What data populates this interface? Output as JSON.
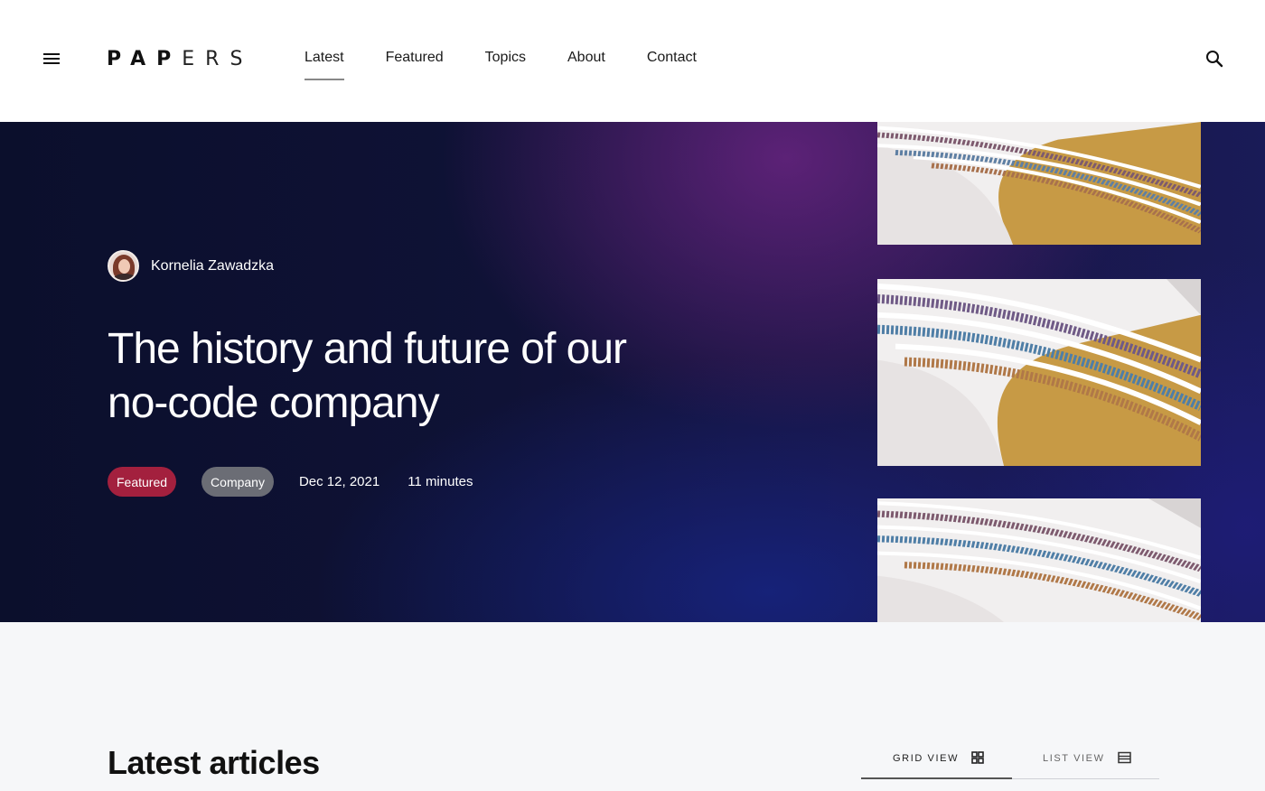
{
  "header": {
    "logo_bold": "PAP",
    "logo_light": "ERS",
    "nav": [
      {
        "label": "Latest",
        "active": true
      },
      {
        "label": "Featured",
        "active": false
      },
      {
        "label": "Topics",
        "active": false
      },
      {
        "label": "About",
        "active": false
      },
      {
        "label": "Contact",
        "active": false
      }
    ],
    "menu_icon": "hamburger-icon",
    "search_icon": "search-icon"
  },
  "hero": {
    "author": "Kornelia Zawadzka",
    "title_line1": "The history and future of our",
    "title_line2": "no-code company",
    "badge_featured": "Featured",
    "badge_company": "Company",
    "date": "Dec 12, 2021",
    "read_time": "11 minutes",
    "colors": {
      "featured_badge": "#a3203e",
      "company_badge": "#6b6d75",
      "background": "#0f1236"
    }
  },
  "latest": {
    "title": "Latest articles",
    "grid_view": "GRID VIEW",
    "list_view": "LIST VIEW",
    "grid_icon": "grid-icon",
    "list_icon": "list-icon"
  }
}
